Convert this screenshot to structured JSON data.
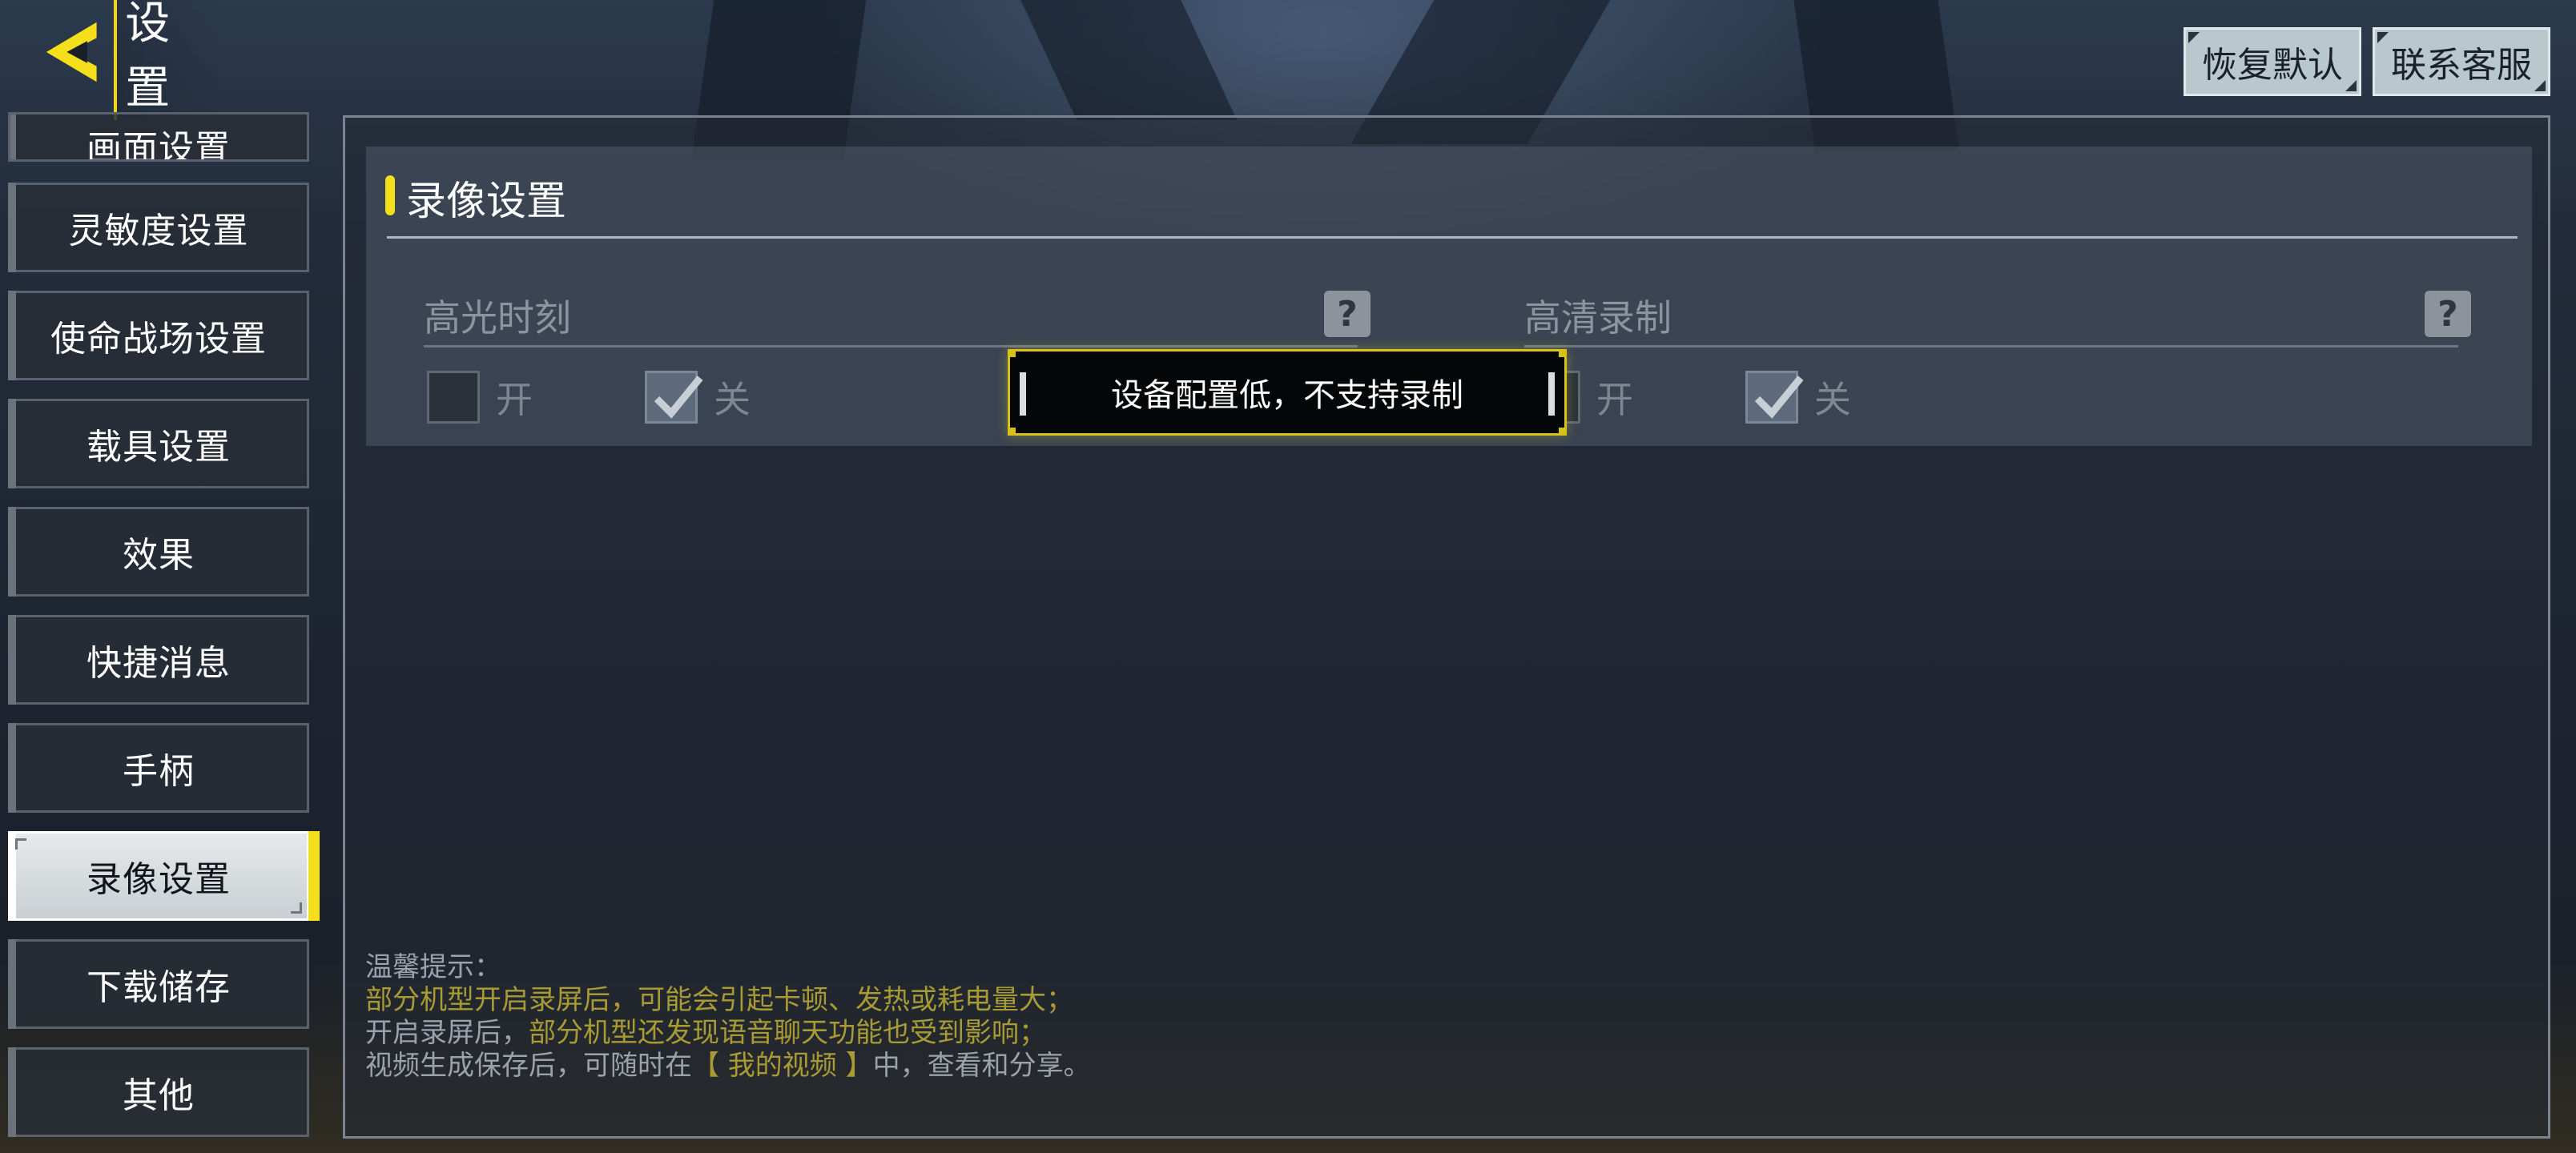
{
  "header": {
    "title": "设置",
    "restore_default": "恢复默认",
    "contact_support": "联系客服"
  },
  "sidebar": {
    "items": [
      {
        "label": "画面设置",
        "partial": true
      },
      {
        "label": "灵敏度设置"
      },
      {
        "label": "使命战场设置"
      },
      {
        "label": "载具设置"
      },
      {
        "label": "效果"
      },
      {
        "label": "快捷消息"
      },
      {
        "label": "手柄"
      },
      {
        "label": "录像设置",
        "active": true
      },
      {
        "label": "下载储存"
      },
      {
        "label": "其他"
      }
    ]
  },
  "section": {
    "title": "录像设置",
    "options": [
      {
        "label": "高光时刻",
        "on_label": "开",
        "off_label": "关",
        "selected": "off"
      },
      {
        "label": "高清录制",
        "on_label": "开",
        "off_label": "关",
        "selected": "off"
      }
    ]
  },
  "toast": {
    "message": "设备配置低，不支持录制"
  },
  "tips": {
    "title": "温馨提示：",
    "line1": "部分机型开启录屏后，可能会引起卡顿、发热或耗电量大；",
    "line2_a": "开启录屏后，",
    "line2_b": "部分机型还发现语音聊天功能也受到影响；",
    "line3_a": "视频生成保存后，可随时在",
    "line3_b": "【 我的视频 】",
    "line3_c": "中，查看和分享。"
  },
  "colors": {
    "accent": "#f5df1a",
    "tip_highlight": "#a99b33",
    "button_bg": "#b9c8cd"
  }
}
